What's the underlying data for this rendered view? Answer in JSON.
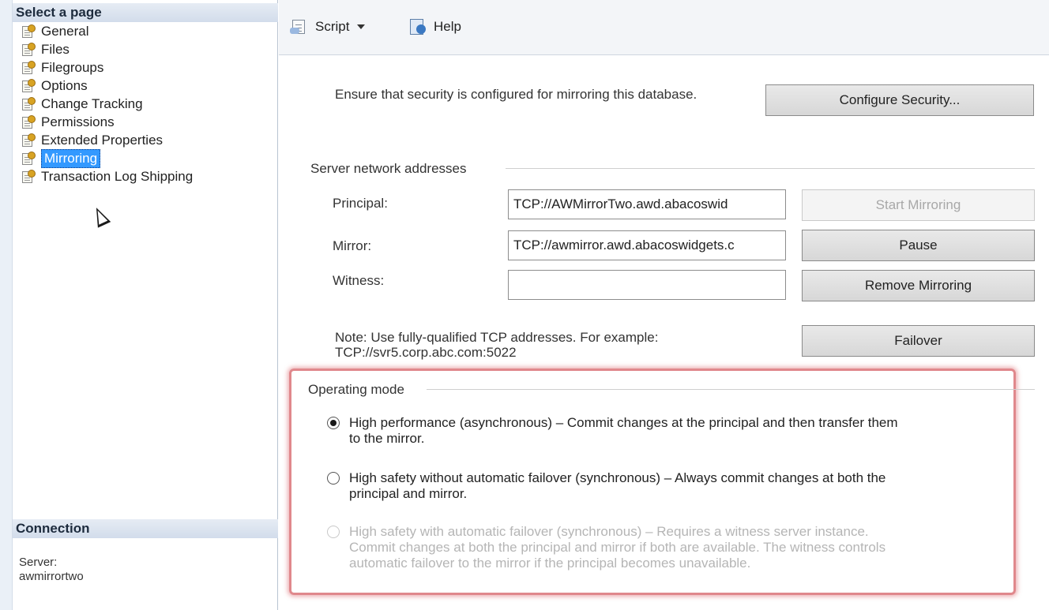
{
  "sidebar": {
    "select_page_header": "Select a page",
    "pages": [
      {
        "label": "General"
      },
      {
        "label": "Files"
      },
      {
        "label": "Filegroups"
      },
      {
        "label": "Options"
      },
      {
        "label": "Change Tracking"
      },
      {
        "label": "Permissions"
      },
      {
        "label": "Extended Properties"
      },
      {
        "label": "Mirroring",
        "selected": true
      },
      {
        "label": "Transaction Log Shipping"
      }
    ],
    "connection_header": "Connection",
    "server_label": "Server:",
    "server_value": "awmirrortwo"
  },
  "toolbar": {
    "script_label": "Script",
    "help_label": "Help",
    "icons": [
      "script-icon",
      "chevron-down-icon",
      "help-icon"
    ]
  },
  "security": {
    "text": "Ensure that security is configured for mirroring this database.",
    "configure_button": "Configure Security..."
  },
  "network": {
    "group_label": "Server network addresses",
    "principal_label": "Principal:",
    "principal_value": "TCP://AWMirrorTwo.awd.abacoswid",
    "mirror_label": "Mirror:",
    "mirror_value": "TCP://awmirror.awd.abacoswidgets.c",
    "witness_label": "Witness:",
    "witness_value": "",
    "start_mirroring_button": "Start Mirroring",
    "pause_button": "Pause",
    "remove_mirroring_button": "Remove Mirroring",
    "failover_button": "Failover",
    "note_line1": "Note: Use fully-qualified TCP addresses. For example:",
    "note_line2": "TCP://svr5.corp.abc.com:5022"
  },
  "operating_mode": {
    "group_label": "Operating mode",
    "options": [
      {
        "line1": "High performance (asynchronous) – Commit changes at the principal and then transfer them",
        "line2": "to the mirror.",
        "checked": true,
        "enabled": true
      },
      {
        "line1": "High safety without automatic failover (synchronous) – Always commit changes at both the",
        "line2": "principal and mirror.",
        "checked": false,
        "enabled": true
      },
      {
        "line1": "High safety with automatic failover (synchronous) – Requires a witness server instance.",
        "line2": "Commit changes at both the principal and mirror if both are available. The witness controls",
        "line3": "automatic failover to the mirror if the principal becomes unavailable.",
        "checked": false,
        "enabled": false
      }
    ]
  },
  "colors": {
    "selection": "#3399ff",
    "highlight_box": "#e0888c"
  }
}
